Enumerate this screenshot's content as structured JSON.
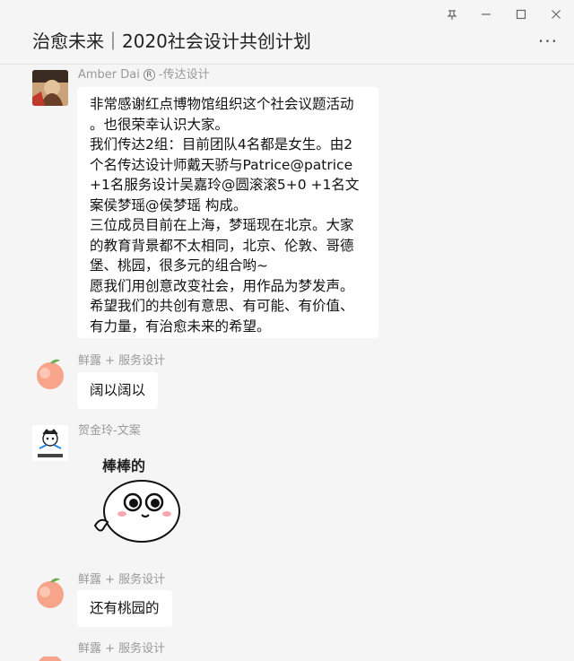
{
  "window": {
    "title": "治愈未来｜2020社会设计共创计划",
    "more_label": "···"
  },
  "messages": [
    {
      "sender_name": "Amber Dai",
      "sender_group": "-传达设计",
      "badge": "R",
      "lines": [
        "非常感谢红点博物馆组织这个社会议题活动",
        "。也很荣幸认识大家。",
        "我们传达2组：目前团队4名都是女生。由2",
        "个名传达设计师戴天骄与Patrice@patrice",
        "+1名服务设计吴嘉玲@圆滚滚5+0 +1名文",
        "案侯梦瑶@侯梦瑶 构成。",
        "三位成员目前在上海，梦瑶现在北京。大家",
        "的教育背景都不太相同，北京、伦敦、哥德",
        "堡、桃园，很多元的组合哟~",
        "愿我们用创意改变社会，用作品为梦发声。",
        "希望我们的共创有意思、有可能、有价值、",
        "有力量，有治愈未来的希望。"
      ]
    },
    {
      "sender": "鲜露 + 服务设计",
      "text": "阔以阔以"
    },
    {
      "sender": "贺金玲-文案",
      "sticker_text": "棒棒的"
    },
    {
      "sender": "鲜露 + 服务设计",
      "text": "还有桃园的"
    },
    {
      "sender": "鲜露 + 服务设计"
    }
  ]
}
